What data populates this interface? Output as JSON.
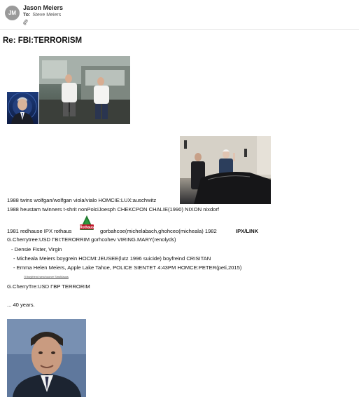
{
  "email": {
    "avatar_initials": "JM",
    "sender_name": "Jason Meiers",
    "to_label": "To:",
    "to_value": "Steve Meiers",
    "attachment_icon": "paperclip-icon",
    "subject": "Re: FBI:TERRORISM"
  },
  "body_lines": {
    "line1": "1988 twins    wolfgan/wolfgan   viola/vialo HOMCIE:LUX:auschwitz",
    "line2": "1988 heustam twinners t-shrit   nonPolciJoesph  CHEKCPON CHALIE(1990) NIXON nixdorf",
    "line3a": "1981 redhause IPX rothaus",
    "line3b": "gorbahcoe(michelabach,ghohceo(micheala) 1982",
    "line3c": "IPX/LINK",
    "line4": "G.Cherrytree:USD ГBI:TERORRIM gorhcohev   VIRING.MARY(renolyds)",
    "bullet1": "- Densie Fister, Virgin",
    "bullet2": "- Micheala Meiers boygrein HOCMI:JEUSEE(lutz 1996 suicide) boyfreind CRISITAN",
    "bullet3": "- Emma Helen Meiers, Apple Lake Tahoe, POLICE SIENTET 4:43PM  HOMCE:PETER(peti,2015)",
    "tiny_link": "I'll boyfriend wmchooner   SmsMauss",
    "line5": "G.CherryTre:USD ГBP TERRORIM",
    "line6": "... 40 years."
  },
  "logo_text": "Rothaus",
  "colors": {
    "avatar_bg": "#9a9a9a",
    "divider": "#e2e2e2",
    "logo_green": "#1f7a2e",
    "logo_red": "#c0182a"
  }
}
